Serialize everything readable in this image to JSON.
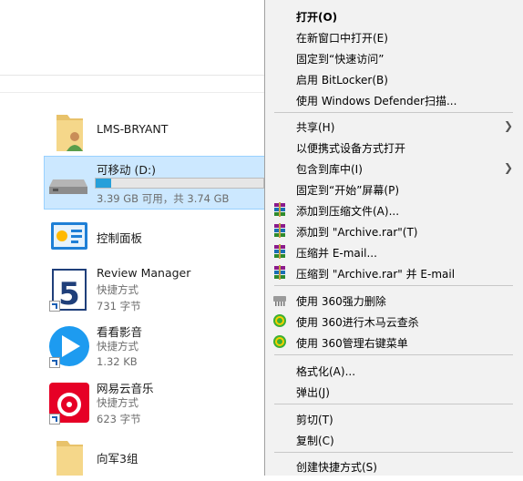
{
  "explorer": {
    "items": [
      {
        "name": "LMS-BRYANT",
        "icon": "user-folder-icon"
      },
      {
        "name": "可移动 (D:)",
        "usage_text": "3.39 GB 可用，共 3.74 GB",
        "used_fraction": 0.094,
        "icon": "removable-drive-icon"
      },
      {
        "name": "控制面板",
        "icon": "control-panel-icon"
      },
      {
        "name": "Review Manager",
        "type": "快捷方式",
        "size": "731 字节",
        "icon": "review-manager-icon"
      },
      {
        "name": "看看影音",
        "type": "快捷方式",
        "size": "1.32 KB",
        "icon": "kankan-player-icon"
      },
      {
        "name": "网易云音乐",
        "type": "快捷方式",
        "size": "623 字节",
        "icon": "netease-music-icon"
      },
      {
        "name": "向军3组",
        "icon": "folder-icon"
      }
    ]
  },
  "context_menu": {
    "items": [
      {
        "label": "打开(O)"
      },
      {
        "label": "在新窗口中打开(E)"
      },
      {
        "label": "固定到“快速访问”"
      },
      {
        "label": "启用 BitLocker(B)"
      },
      {
        "label": "使用 Windows Defender扫描..."
      },
      {
        "label": "共享(H)"
      },
      {
        "label": "以便携式设备方式打开"
      },
      {
        "label": "包含到库中(I)"
      },
      {
        "label": "固定到“开始”屏幕(P)"
      },
      {
        "label": "添加到压缩文件(A)...",
        "icon": "winrar-icon"
      },
      {
        "label": "添加到 \"Archive.rar\"(T)",
        "icon": "winrar-icon"
      },
      {
        "label": "压缩并 E-mail...",
        "icon": "winrar-icon"
      },
      {
        "label": "压缩到 \"Archive.rar\" 并 E-mail",
        "icon": "winrar-icon"
      },
      {
        "label": "使用 360强力删除",
        "icon": "shredder-icon"
      },
      {
        "label": "使用 360进行木马云查杀",
        "icon": "360-icon"
      },
      {
        "label": "使用 360管理右键菜单",
        "icon": "360-icon"
      },
      {
        "label": "格式化(A)..."
      },
      {
        "label": "弹出(J)"
      },
      {
        "label": "剪切(T)"
      },
      {
        "label": "复制(C)"
      },
      {
        "label": "创建快捷方式(S)"
      }
    ]
  },
  "colors": {
    "selection": "#cce8ff",
    "progress": "#26a0da",
    "menu_bg": "#f2f2f2"
  }
}
